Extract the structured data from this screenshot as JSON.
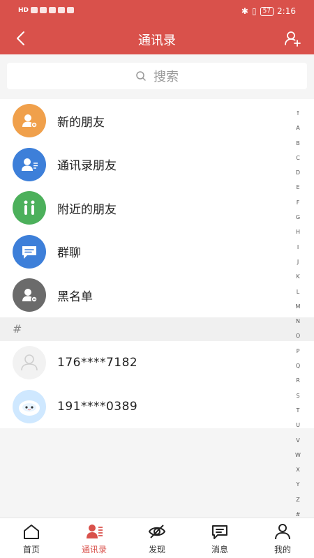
{
  "status": {
    "time": "2:16",
    "battery": "57",
    "net_label": "HD"
  },
  "header": {
    "title": "通讯录"
  },
  "search": {
    "placeholder": "搜索"
  },
  "menu": [
    {
      "label": "新的朋友",
      "icon": "new-friends-icon",
      "color": "#f0a04b"
    },
    {
      "label": "通讯录朋友",
      "icon": "contacts-friends-icon",
      "color": "#3d7fd9"
    },
    {
      "label": "附近的朋友",
      "icon": "nearby-friends-icon",
      "color": "#4cb05b"
    },
    {
      "label": "群聊",
      "icon": "group-chat-icon",
      "color": "#3d7fd9"
    },
    {
      "label": "黑名单",
      "icon": "blacklist-icon",
      "color": "#6b6b6b"
    }
  ],
  "section": {
    "label": "#"
  },
  "contacts": [
    {
      "name": "176****7182",
      "avatar": "default-avatar-icon"
    },
    {
      "name": "191****0389",
      "avatar": "robot-avatar-icon"
    }
  ],
  "index": [
    "↑",
    "A",
    "B",
    "C",
    "D",
    "E",
    "F",
    "G",
    "H",
    "I",
    "J",
    "K",
    "L",
    "M",
    "N",
    "O",
    "P",
    "Q",
    "R",
    "S",
    "T",
    "U",
    "V",
    "W",
    "X",
    "Y",
    "Z",
    "#"
  ],
  "tabs": [
    {
      "label": "首页",
      "icon": "home-icon"
    },
    {
      "label": "通讯录",
      "icon": "contacts-icon",
      "active": true
    },
    {
      "label": "发现",
      "icon": "discover-icon"
    },
    {
      "label": "消息",
      "icon": "message-icon"
    },
    {
      "label": "我的",
      "icon": "profile-icon"
    }
  ],
  "colors": {
    "brand": "#d9514b"
  }
}
